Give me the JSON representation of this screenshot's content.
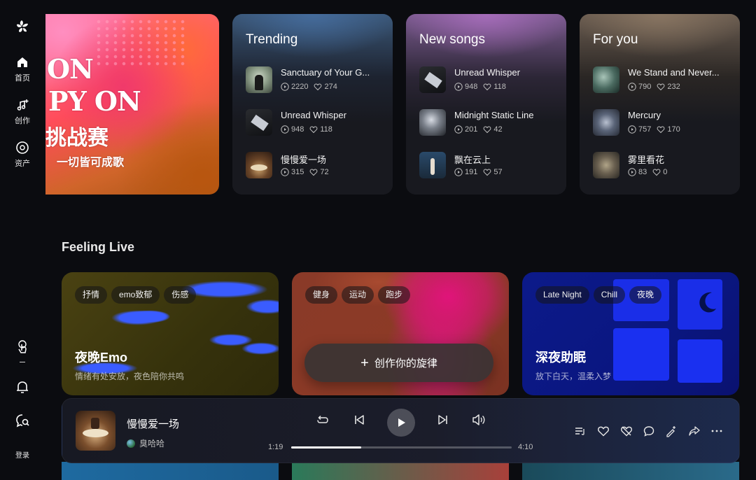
{
  "sidebar": {
    "logo": "app-logo",
    "nav": [
      {
        "label": "首页",
        "icon": "home-icon"
      },
      {
        "label": "创作",
        "icon": "music-create-icon"
      },
      {
        "label": "资产",
        "icon": "disc-icon"
      }
    ],
    "bottom_icons": [
      "touch-icon",
      "bell-icon",
      "chat-search-icon"
    ],
    "login": "登录"
  },
  "hero": {
    "line1": "ON",
    "line2": "PY ON",
    "line3": "挑战赛",
    "line4": "一切皆可成歌"
  },
  "top_cards": [
    {
      "title": "Trending",
      "songs": [
        {
          "name": "Sanctuary of Your G...",
          "plays": "2220",
          "likes": "274"
        },
        {
          "name": "Unread Whisper",
          "plays": "948",
          "likes": "118"
        },
        {
          "name": "慢慢爱一场",
          "plays": "315",
          "likes": "72"
        }
      ]
    },
    {
      "title": "New songs",
      "songs": [
        {
          "name": "Unread Whisper",
          "plays": "948",
          "likes": "118"
        },
        {
          "name": "Midnight Static Line",
          "plays": "201",
          "likes": "42"
        },
        {
          "name": "飘在云上",
          "plays": "191",
          "likes": "57"
        }
      ]
    },
    {
      "title": "For you",
      "songs": [
        {
          "name": "We Stand and Never...",
          "plays": "790",
          "likes": "232"
        },
        {
          "name": "Mercury",
          "plays": "757",
          "likes": "170"
        },
        {
          "name": "雾里看花",
          "plays": "83",
          "likes": "0"
        }
      ]
    }
  ],
  "feeling_live": {
    "title": "Feeling Live",
    "cards": [
      {
        "tags": [
          "抒情",
          "emo致郁",
          "伤感"
        ],
        "title": "夜晚Emo",
        "subtitle": "情绪有处安放，夜色陪你共鸣"
      },
      {
        "tags": [
          "健身",
          "运动",
          "跑步"
        ],
        "title": "",
        "subtitle": ""
      },
      {
        "tags": [
          "Late Night",
          "Chill",
          "夜晚"
        ],
        "title": "深夜助眠",
        "subtitle": "放下白天，温柔入梦"
      }
    ]
  },
  "create_button": "创作你的旋律",
  "player": {
    "title": "慢慢爱一场",
    "artist": "臭哈哈",
    "current_time": "1:19",
    "total_time": "4:10",
    "progress": 0.316
  },
  "colors": {
    "accent": "#ffffff",
    "background": "#0b0c10",
    "card": "#1c1e24"
  }
}
